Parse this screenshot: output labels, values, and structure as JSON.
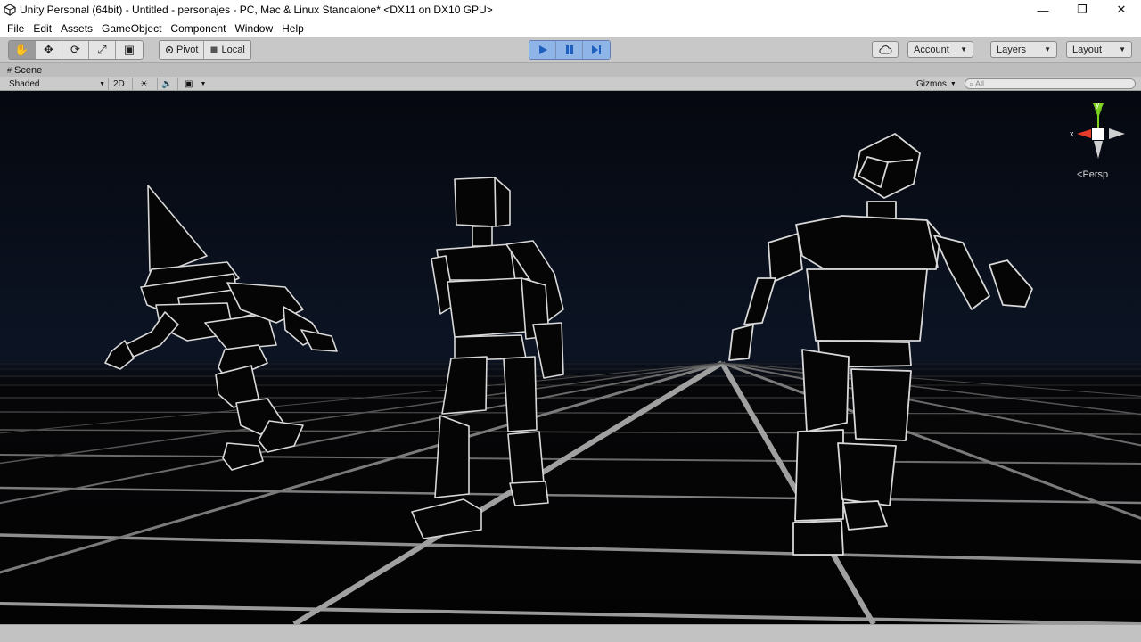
{
  "window": {
    "title": "Unity Personal (64bit) - Untitled - personajes - PC, Mac & Linux Standalone* <DX11 on DX10 GPU>",
    "minimize_glyph": "—",
    "maximize_glyph": "❐",
    "close_glyph": "✕"
  },
  "menu": {
    "items": [
      {
        "label": "File"
      },
      {
        "label": "Edit"
      },
      {
        "label": "Assets"
      },
      {
        "label": "GameObject"
      },
      {
        "label": "Component"
      },
      {
        "label": "Window"
      },
      {
        "label": "Help"
      }
    ]
  },
  "toolbar": {
    "tools": [
      {
        "name": "hand-tool",
        "glyph": "✋",
        "active": true
      },
      {
        "name": "move-tool",
        "glyph": "✥",
        "active": false
      },
      {
        "name": "rotate-tool",
        "glyph": "⟳",
        "active": false
      },
      {
        "name": "scale-tool",
        "glyph": "⤢",
        "active": false
      },
      {
        "name": "rect-tool",
        "glyph": "▣",
        "active": false
      }
    ],
    "pivot_label": "Pivot",
    "local_label": "Local",
    "playback": {
      "play": "play-icon",
      "pause": "pause-icon",
      "step": "step-icon"
    },
    "cloud_icon": "cloud-icon",
    "account_label": "Account",
    "layers_label": "Layers",
    "layout_label": "Layout",
    "accent_color": "#2a6fd6"
  },
  "scene": {
    "tab_label": "Scene",
    "shading_mode": "Shaded",
    "mode_2d": "2D",
    "gizmos_label": "Gizmos",
    "search_placeholder": "All",
    "gizmo": {
      "x_label": "x",
      "y_label": "y",
      "projection_label": "Persp"
    }
  }
}
